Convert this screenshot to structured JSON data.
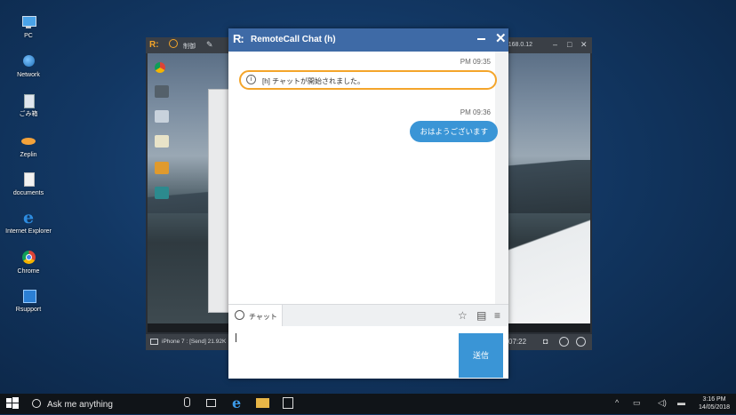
{
  "desktop": {
    "icons": [
      {
        "label": "PC",
        "icon": "computer-icon"
      },
      {
        "label": "Network",
        "icon": "network-icon"
      },
      {
        "label": "ごみ箱",
        "icon": "recycle-bin-icon"
      },
      {
        "label": "Zeplin",
        "icon": "zeplin-icon"
      },
      {
        "label": "documents",
        "icon": "document-icon"
      },
      {
        "label": "Internet Explorer",
        "icon": "ie-icon"
      },
      {
        "label": "Chrome",
        "icon": "chrome-icon"
      },
      {
        "label": "Rsupport",
        "icon": "rsupport-icon"
      }
    ]
  },
  "viewer": {
    "toolbar_label": "制御",
    "ip": "92.168.0.12",
    "status_text": "iPhone 7 : [Send] 21.92K",
    "elapsed": "07:22"
  },
  "chat": {
    "logo": "R:",
    "title": "RemoteCall Chat (h)",
    "messages": [
      {
        "time": "PM 09:35",
        "text": "[h] チャットが開始されました。",
        "kind": "system"
      },
      {
        "time": "PM 09:36",
        "text": "おはようございます",
        "kind": "outgoing"
      }
    ],
    "tab_label": "チャット",
    "send_label": "送信"
  },
  "taskbar": {
    "search_placeholder": "Ask me anything",
    "time": "3:16 PM",
    "date": "14/05/2018"
  },
  "colors": {
    "chat_header": "#3e6aa6",
    "accent_blue": "#3a95d6",
    "system_border": "#f4a52a"
  }
}
